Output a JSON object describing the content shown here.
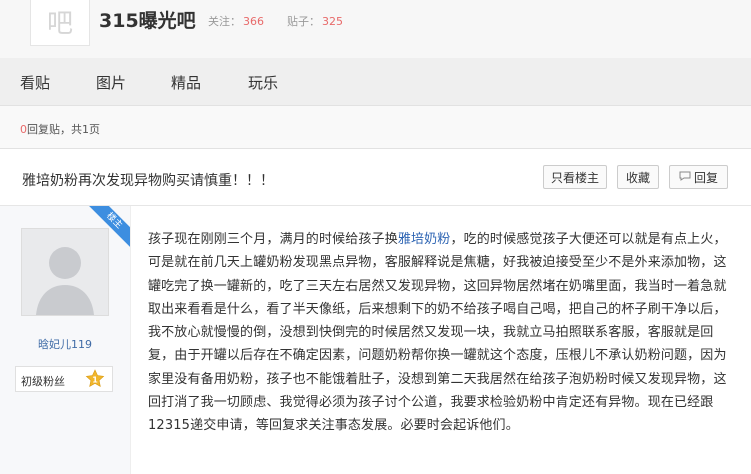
{
  "header": {
    "logo_text": "吧",
    "forum_name": "315曝光吧",
    "follow_label": "关注：",
    "follow_count": "366",
    "posts_label": "贴子：",
    "posts_count": "325"
  },
  "nav": {
    "tabs": [
      {
        "label": "看贴"
      },
      {
        "label": "图片"
      },
      {
        "label": "精品"
      },
      {
        "label": "玩乐"
      }
    ]
  },
  "info": {
    "reply_count": "0",
    "reply_text": "回复贴，共1页"
  },
  "thread": {
    "title": "雅培奶粉再次发现异物购买请慎重！！！",
    "only_owner_label": "只看楼主",
    "favorite_label": "收藏",
    "reply_label": "回复"
  },
  "post": {
    "owner_badge": "楼主",
    "username": "晗妃儿119",
    "level_label": "初级粉丝",
    "level_number": "1",
    "content_before_link": "孩子现在刚刚三个月，满月的时候给孩子换",
    "content_link": "雅培奶粉",
    "content_after_link": "，吃的时候感觉孩子大便还可以就是有点上火，可是就在前几天上罐奶粉发现黑点异物，客服解释说是焦糖，好我被迫接受至少不是外来添加物，这罐吃完了换一罐新的，吃了三天左右居然又发现异物，这回异物居然堵在奶嘴里面，我当时一着急就取出来看看是什么，看了半天像纸，后来想剩下的奶不给孩子喝自己喝，把自己的杯子刷干净以后，我不放心就慢慢的倒，没想到快倒完的时候居然又发现一块，我就立马拍照联系客服，客服就是回复，由于开罐以后存在不确定因素，问题奶粉帮你换一罐就这个态度，压根儿不承认奶粉问题，因为家里没有备用奶粉，孩子也不能饿着肚子，没想到第二天我居然在给孩子泡奶粉时候又发现异物，这回打消了我一切顾虑、我觉得必须为孩子讨个公道，我要求检验奶粉中肯定还有异物。现在已经跟12315递交申请，等回复求关注事态发展。必要时会起诉他们。"
  },
  "colors": {
    "accent_red": "#e86a6a",
    "link_blue": "#2d64b3",
    "badge_blue": "#3d8ee0"
  }
}
